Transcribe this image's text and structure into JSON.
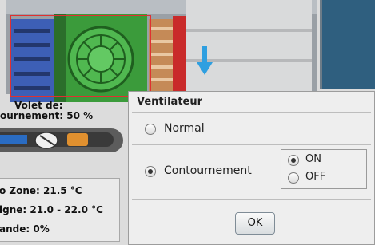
{
  "schematic": {
    "shutter_label_line1": "Volet de:",
    "shutter_label_line2": "ournement:  50 %",
    "info": [
      {
        "text": "o Zone: 21.5 °C"
      },
      {
        "text": "igne: 21.0 - 22.0 °C"
      },
      {
        "text": "ande: 0%"
      }
    ],
    "airflow_arrow": "arrow-down-icon"
  },
  "dialog": {
    "title": "Ventilateur",
    "options": [
      {
        "label": "Normal",
        "checked": false
      },
      {
        "label": "Contournement",
        "checked": true
      }
    ],
    "sub_options": [
      {
        "label": "ON",
        "checked": true
      },
      {
        "label": "OFF",
        "checked": false
      }
    ],
    "ok_label": "OK"
  },
  "colors": {
    "fan": "#3b9b3b",
    "filter": "#3d5fb6",
    "damper": "#c58a57",
    "heater_bar": "#c92a2a",
    "selection": "#e03030",
    "arrow": "#2f9fe0"
  }
}
